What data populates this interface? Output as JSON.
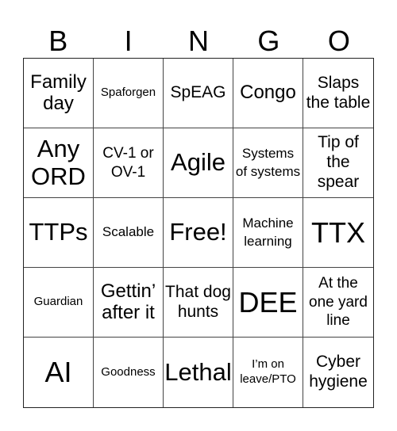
{
  "header": [
    "B",
    "I",
    "N",
    "G",
    "O"
  ],
  "cells": [
    {
      "text": "Family day",
      "size": "s-m"
    },
    {
      "text": "Spaforgen",
      "size": "s-xxs"
    },
    {
      "text": "SpEAG",
      "size": "s-ms"
    },
    {
      "text": "Congo",
      "size": "s-m"
    },
    {
      "text": "Slaps the table",
      "size": "s-ms"
    },
    {
      "text": "Any ORD",
      "size": "s-l"
    },
    {
      "text": "CV-1 or OV-1",
      "size": "s-s"
    },
    {
      "text": "Agile",
      "size": "s-l"
    },
    {
      "text": "Systems of systems",
      "size": "s-xs"
    },
    {
      "text": "Tip of the spear",
      "size": "s-ms"
    },
    {
      "text": "TTPs",
      "size": "s-l"
    },
    {
      "text": "Scalable",
      "size": "s-xs"
    },
    {
      "text": "Free!",
      "size": "s-l"
    },
    {
      "text": "Machine learning",
      "size": "s-xs"
    },
    {
      "text": "TTX",
      "size": "s-xl"
    },
    {
      "text": "Guardian",
      "size": "s-xxs"
    },
    {
      "text": "Gettin’ after it",
      "size": "s-m"
    },
    {
      "text": "That dog hunts",
      "size": "s-ms"
    },
    {
      "text": "DEE",
      "size": "s-xl"
    },
    {
      "text": "At the one yard line",
      "size": "s-s"
    },
    {
      "text": "AI",
      "size": "s-xl"
    },
    {
      "text": "Goodness",
      "size": "s-xxs"
    },
    {
      "text": "Lethal",
      "size": "s-l"
    },
    {
      "text": "I’m on leave/PTO",
      "size": "s-xxs"
    },
    {
      "text": "Cyber hygiene",
      "size": "s-ms"
    }
  ]
}
